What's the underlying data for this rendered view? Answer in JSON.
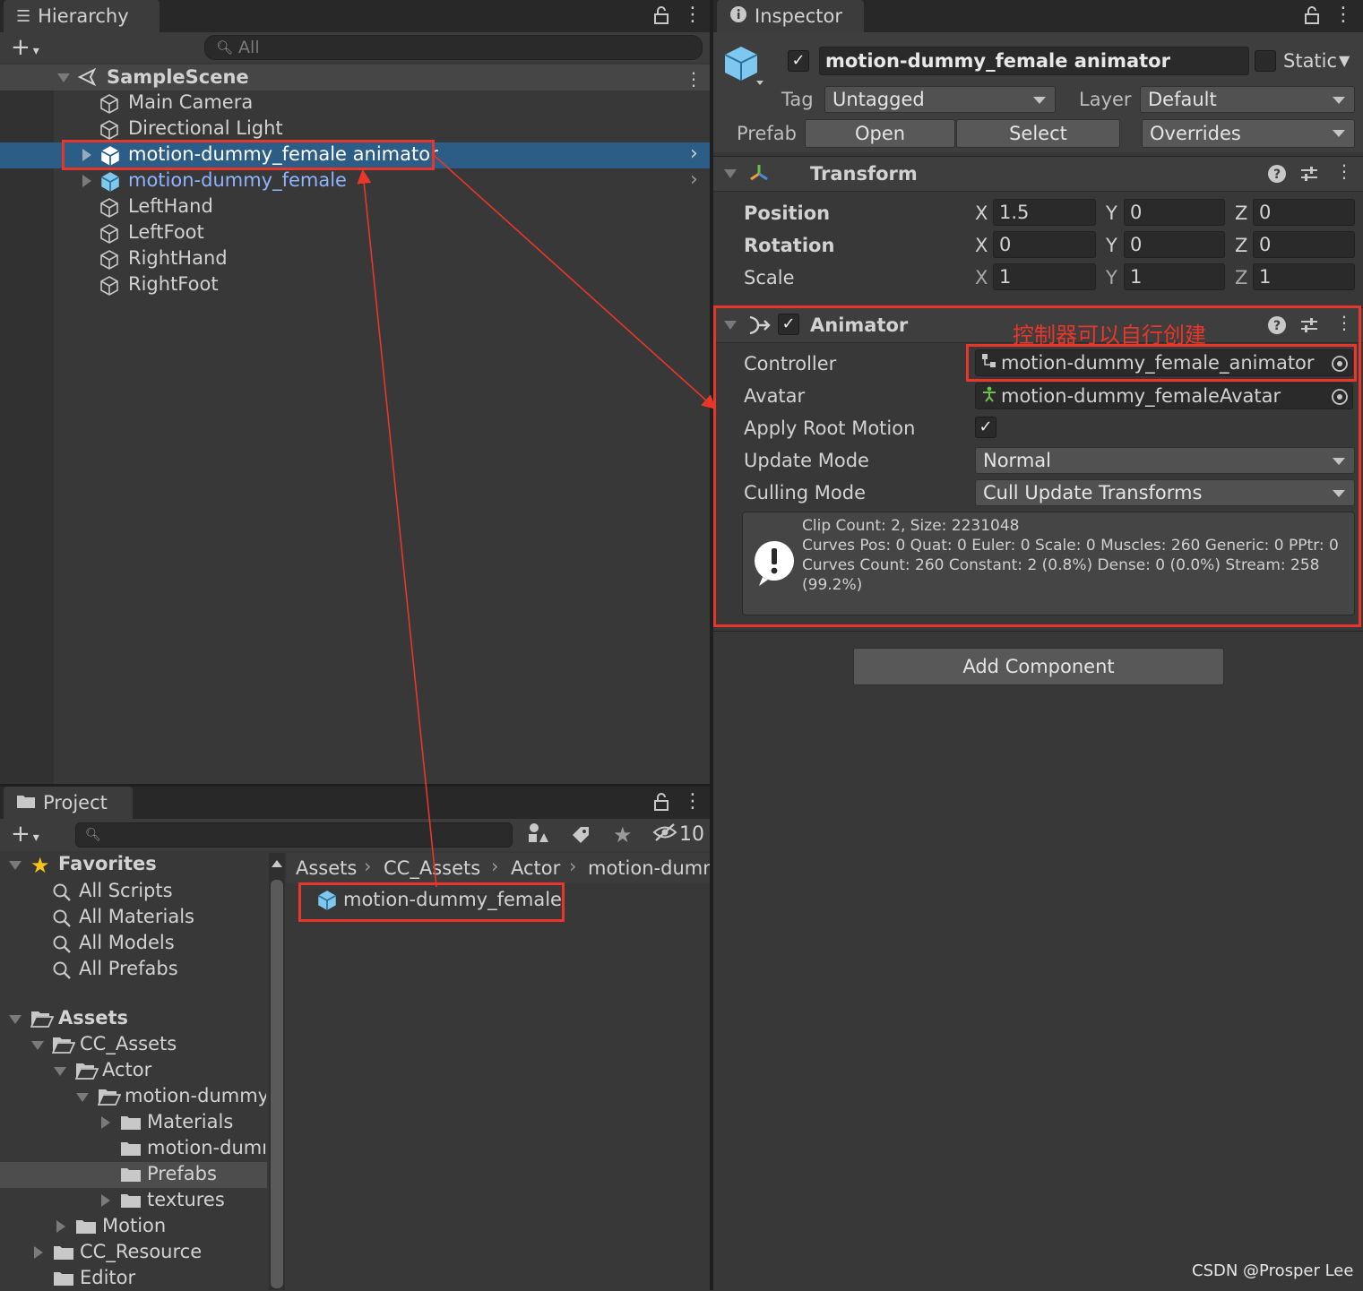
{
  "hierarchy": {
    "tab_label": "Hierarchy",
    "search_placeholder": "All",
    "scene_name": "SampleScene",
    "items": [
      {
        "label": "Main Camera"
      },
      {
        "label": "Directional Light"
      },
      {
        "label": "motion-dummy_female animator",
        "selected": true
      },
      {
        "label": "motion-dummy_female",
        "prefab": true
      },
      {
        "label": "LeftHand"
      },
      {
        "label": "LeftFoot"
      },
      {
        "label": "RightHand"
      },
      {
        "label": "RightFoot"
      }
    ]
  },
  "project": {
    "tab_label": "Project",
    "hidden_count": "10",
    "favorites": {
      "label": "Favorites",
      "items": [
        "All Scripts",
        "All Materials",
        "All Models",
        "All Prefabs"
      ]
    },
    "tree": {
      "assets": "Assets",
      "cc_assets": "CC_Assets",
      "actor": "Actor",
      "motion_dummy": "motion-dummy_",
      "materials": "Materials",
      "motion_dumr": "motion-dumr",
      "prefabs": "Prefabs",
      "textures": "textures",
      "motion": "Motion",
      "cc_resource": "CC_Resource",
      "editor": "Editor"
    },
    "breadcrumb": [
      "Assets",
      "CC_Assets",
      "Actor",
      "motion-dumm"
    ],
    "file_item": "motion-dummy_female"
  },
  "inspector": {
    "tab_label": "Inspector",
    "object_name": "motion-dummy_female animator",
    "static_label": "Static",
    "tag_label": "Tag",
    "tag_value": "Untagged",
    "layer_label": "Layer",
    "layer_value": "Default",
    "prefab_label": "Prefab",
    "prefab_open": "Open",
    "prefab_select": "Select",
    "prefab_overrides": "Overrides",
    "transform": {
      "title": "Transform",
      "position_label": "Position",
      "rotation_label": "Rotation",
      "scale_label": "Scale",
      "axis_x": "X",
      "axis_y": "Y",
      "axis_z": "Z",
      "position": [
        "1.5",
        "0",
        "0"
      ],
      "rotation": [
        "0",
        "0",
        "0"
      ],
      "scale": [
        "1",
        "1",
        "1"
      ]
    },
    "animator": {
      "title": "Animator",
      "annotation": "控制器可以自行创建",
      "controller_label": "Controller",
      "controller_value": "motion-dummy_female_animator",
      "avatar_label": "Avatar",
      "avatar_value": "motion-dummy_femaleAvatar",
      "apply_root_motion_label": "Apply Root Motion",
      "update_mode_label": "Update Mode",
      "update_mode_value": "Normal",
      "culling_mode_label": "Culling Mode",
      "culling_mode_value": "Cull Update Transforms",
      "info_lines": [
        "Clip Count: 2, Size: 2231048",
        "Curves Pos: 0 Quat: 0 Euler: 0 Scale: 0 Muscles: 260 Generic: 0 PPtr: 0",
        "Curves Count: 260 Constant: 2 (0.8%) Dense: 0 (0.0%) Stream: 258",
        "(99.2%)"
      ]
    },
    "add_component": "Add Component"
  },
  "watermark": "CSDN @Prosper Lee",
  "colors": {
    "annotation_red": "#e8362a",
    "selection_blue": "#2c5d87",
    "prefab_blue": "#8eb4ff",
    "panel_bg": "#383838"
  }
}
